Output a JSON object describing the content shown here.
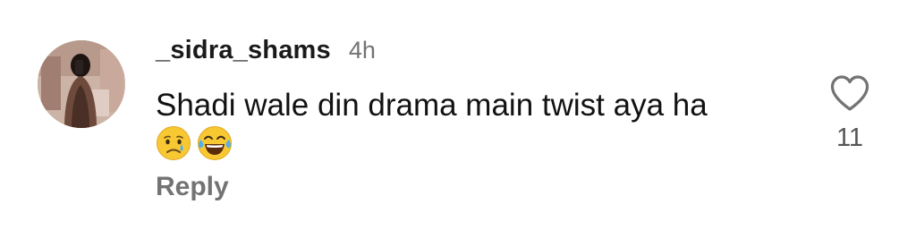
{
  "comment": {
    "username": "_sidra_shams",
    "time": "4h",
    "text": "Shadi wale din drama main twist aya ha",
    "emojis": [
      "crying-face-emoji",
      "tears-of-joy-emoji"
    ],
    "reply_label": "Reply",
    "like_count": "11",
    "avatar_icon": "user-avatar"
  },
  "colors": {
    "text": "#121212",
    "secondary": "#737373",
    "heart_outline": "#737373"
  }
}
